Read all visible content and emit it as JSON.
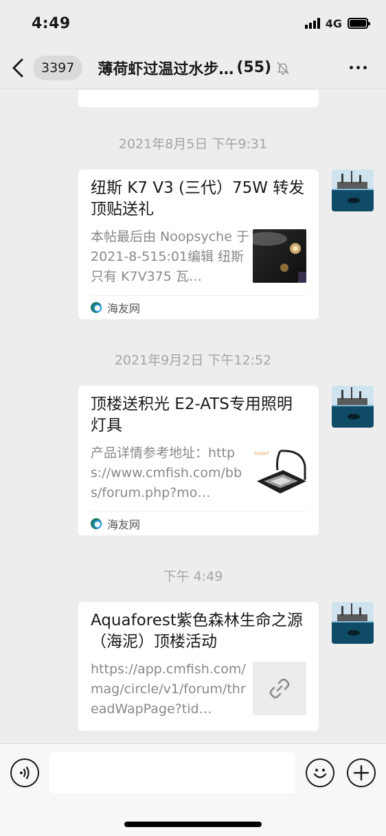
{
  "status": {
    "time": "4:49",
    "network": "4G"
  },
  "nav": {
    "unread_count": "3397",
    "title": "薄荷虾过温过水步…",
    "member_count": "(55)"
  },
  "messages": [
    {
      "timestamp": "2021年8月5日 下午9:31",
      "title": "纽斯 K7 V3 (三代）75W 转发顶贴送礼",
      "description": "本帖最后由 Noopsyche 于 2021-8-515:01编辑 纽斯只有 K7V375 瓦…",
      "source": "海友网",
      "thumb_icon": "aquarium-light-photo"
    },
    {
      "timestamp": "2021年9月2日 下午12:52",
      "title": "顶楼送积光 E2-ATS专用照明灯具",
      "description": "产品详情参考地址：https://www.cmfish.com/bbs/forum.php?mo…",
      "source": "海友网",
      "thumb_icon": "lamp-product-photo",
      "thumb_caption": "TLIGHT"
    },
    {
      "timestamp": "下午 4:49",
      "title": "Aquaforest紫色森林生命之源（海泥）顶楼活动",
      "description": "https://app.cmfish.com/mag/circle/v1/forum/threadWapPage?tid…",
      "thumb_icon": "link-icon"
    }
  ],
  "input": {
    "placeholder": ""
  },
  "colors": {
    "background": "#ededed",
    "card": "#ffffff",
    "timestamp": "#a5a5a5",
    "description": "#888888"
  }
}
